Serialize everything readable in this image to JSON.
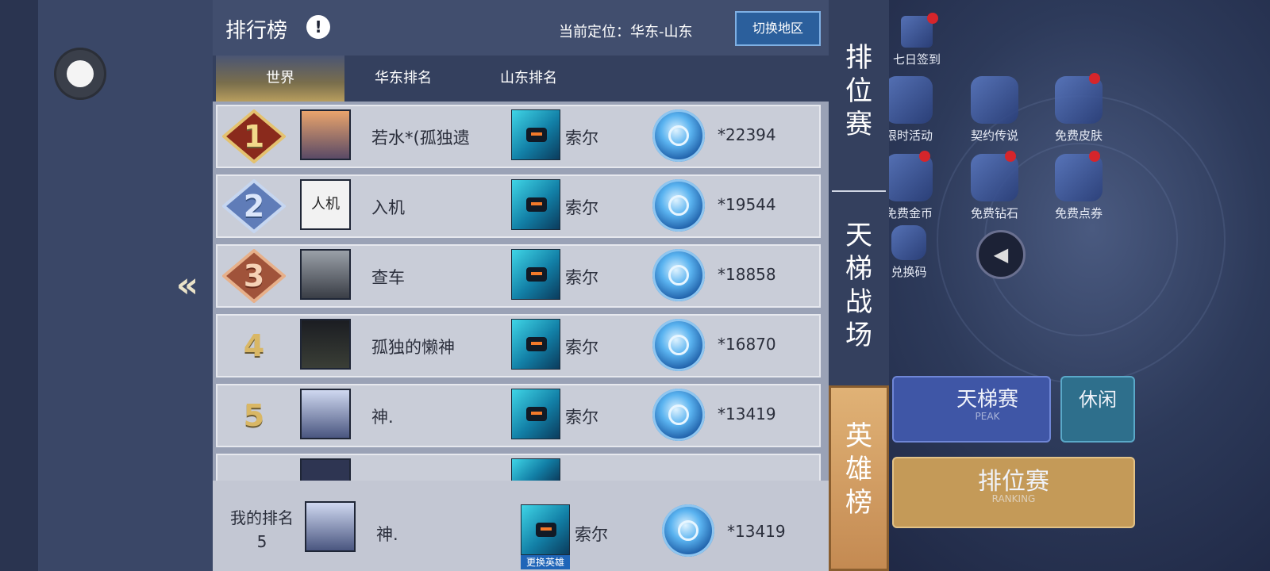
{
  "header": {
    "title": "排行榜",
    "location": "当前定位：华东-山东",
    "switch_button": "切换地区"
  },
  "tabs": [
    {
      "label": "世界",
      "active": true
    },
    {
      "label": "华东排名",
      "active": false
    },
    {
      "label": "山东排名",
      "active": false
    }
  ],
  "rows": [
    {
      "rank": "1",
      "name": "若水*(孤独遗",
      "hero": "索尔",
      "score": "*22394"
    },
    {
      "rank": "2",
      "name": "入机",
      "avatar_text": "人机",
      "hero": "索尔",
      "score": "*19544"
    },
    {
      "rank": "3",
      "name": "查车",
      "hero": "索尔",
      "score": "*18858"
    },
    {
      "rank": "4",
      "name": "孤独的懒神",
      "hero": "索尔",
      "score": "*16870"
    },
    {
      "rank": "5",
      "name": "神.",
      "hero": "索尔",
      "score": "*13419"
    }
  ],
  "my_rank": {
    "label": "我的排名",
    "rank": "5",
    "name": "神.",
    "hero": "索尔",
    "change_hero": "更换英雄",
    "score": "*13419"
  },
  "side_tabs": [
    {
      "label": "排位赛",
      "active": false
    },
    {
      "label": "天梯战场",
      "active": false
    },
    {
      "label": "英雄榜",
      "active": true
    }
  ],
  "background_menu": {
    "checkin": "七日签到",
    "items": [
      "限时活动",
      "契约传说",
      "免费皮肤",
      "免费金币",
      "免费钻石",
      "免费点券",
      "兑换码"
    ],
    "ladder_mode": "天梯赛",
    "ladder_sub": "PEAK",
    "casual_mode": "休闲",
    "ranked_mode": "排位赛",
    "ranked_sub": "RANKING"
  },
  "colors": {
    "gold": "#d9b765",
    "panel": "#9aa2b6",
    "accent_blue": "#2b5f9c",
    "active_tab": "#c48a52"
  }
}
